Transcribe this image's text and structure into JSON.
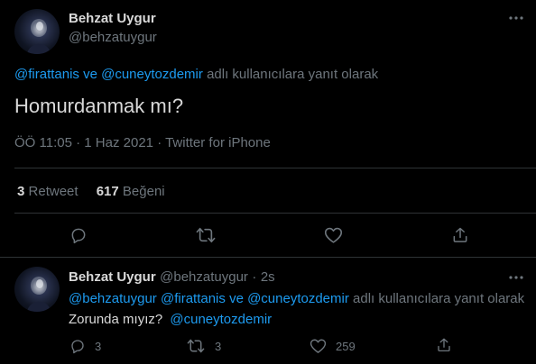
{
  "colors": {
    "background": "#000000",
    "text": "#d9d9d9",
    "muted": "#6e767d",
    "link": "#1d9bf0",
    "divider": "#2f3336"
  },
  "main_tweet": {
    "author_name": "Behzat Uygur",
    "author_handle": "@behzatuygur",
    "more_icon": "more-horizontal-icon",
    "reply_to": {
      "handle_1": "@firattanis",
      "connector": "ve",
      "handle_2": "@cuneytozdemir",
      "suffix": "adlı kullanıcılara yanıt olarak"
    },
    "text": "Homurdanmak mı?",
    "time": "ÖÖ 11:05",
    "separator": "·",
    "date": "1 Haz 2021",
    "source": "Twitter for iPhone",
    "stats": {
      "retweet_count": "3",
      "retweet_label": "Retweet",
      "like_count": "617",
      "like_label": "Beğeni"
    },
    "actions": [
      "reply-icon",
      "retweet-icon",
      "like-icon",
      "share-icon"
    ]
  },
  "reply_tweet": {
    "author_name": "Behzat Uygur",
    "author_handle": "@behzatuygur",
    "separator": "·",
    "time_ago": "2s",
    "more_icon": "more-horizontal-icon",
    "reply_to": {
      "handle_1": "@behzatuygur",
      "handle_2": "@firattanis",
      "connector": "ve",
      "handle_3": "@cuneytozdemir",
      "suffix": "adlı kullanıcılara yanıt olarak"
    },
    "text": "Zorunda mıyız?",
    "mention": "@cuneytozdemir",
    "counts": {
      "reply": "3",
      "retweet": "3",
      "like": "259"
    }
  }
}
